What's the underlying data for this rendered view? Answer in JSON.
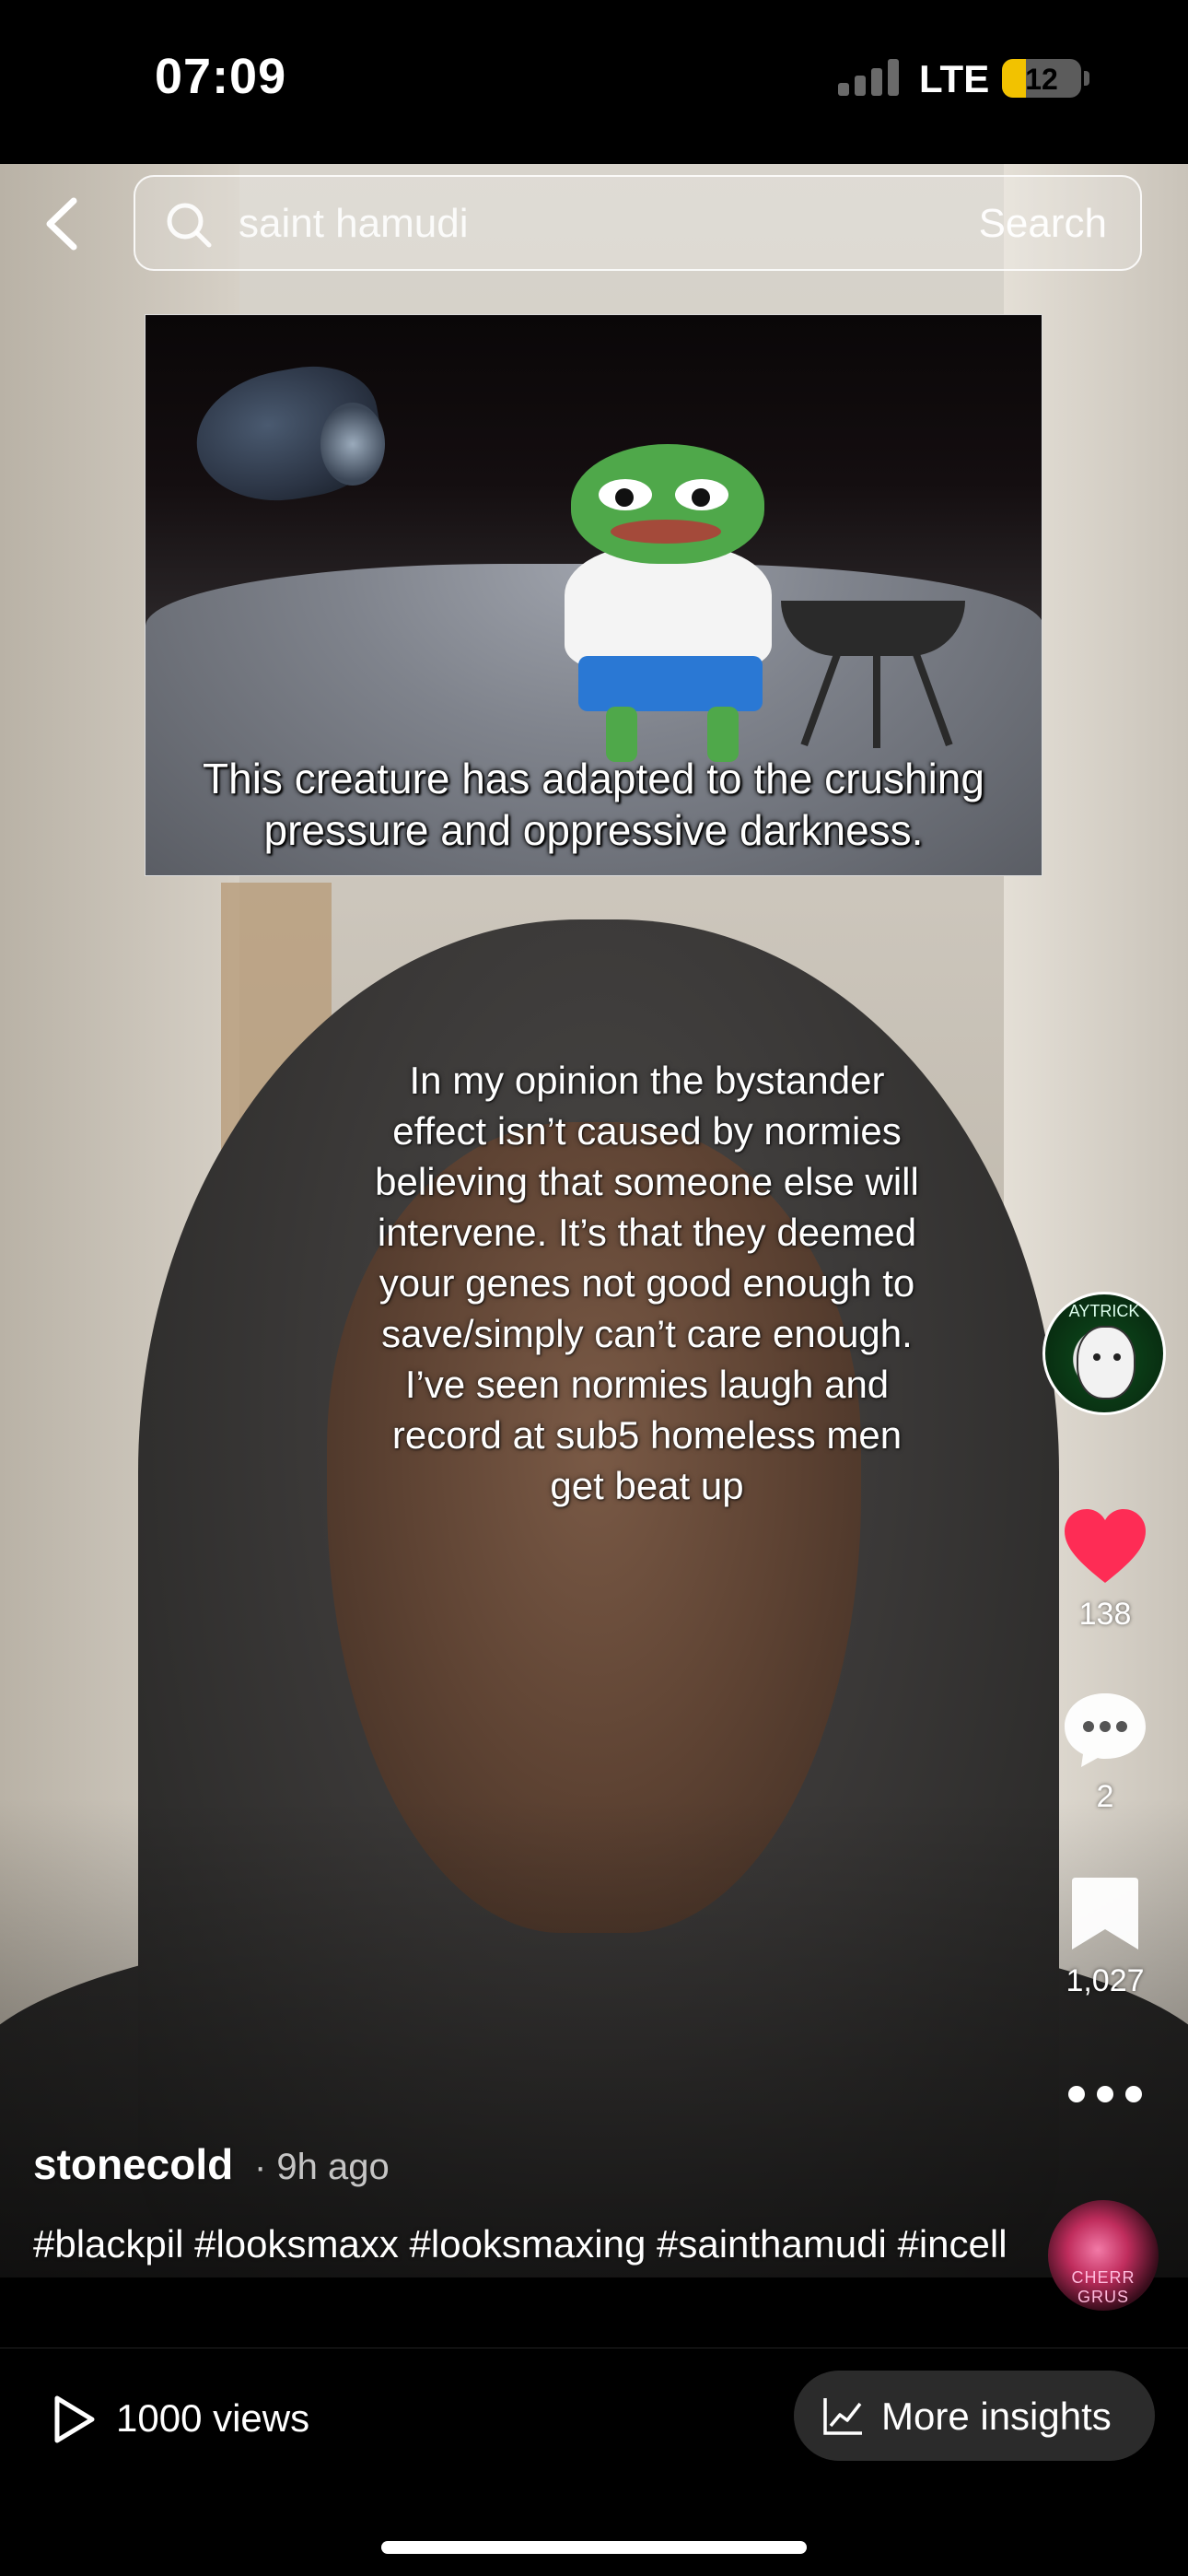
{
  "status_bar": {
    "time": "07:09",
    "network": "LTE",
    "battery": "12",
    "battery_level_percent": 12,
    "battery_color": "#f2c200"
  },
  "search": {
    "query": "saint hamudi",
    "button_label": "Search"
  },
  "meme": {
    "caption": "This creature has adapted to the crushing pressure and oppressive darkness."
  },
  "video": {
    "overlay_text": "In my opinion the bystander effect isn’t caused by normies believing that someone else will intervene. It’s that they deemed your genes not good enough to save/simply can’t care enough. I’ve seen normies laugh and record at sub5 homeless men get beat up"
  },
  "creator": {
    "avatar_tag": "AYTRICK"
  },
  "actions": {
    "likes": "138",
    "comments": "2",
    "saves": "1,027",
    "like_color": "#fe2c55"
  },
  "caption": {
    "username": "stonecold",
    "time_ago": "· 9h ago",
    "hashtags": "#blackpil #looksmaxx #looksmaxing #sainthamudi #incell"
  },
  "music": {
    "disc_text": "CHERR GRUS"
  },
  "bottom_bar": {
    "views": "1000 views",
    "insights_label": "More insights"
  },
  "icons": {
    "back": "chevron-left-icon",
    "search": "search-icon",
    "like": "heart-icon",
    "comment": "comment-bubble-icon",
    "save": "bookmark-icon",
    "more": "more-dots-icon",
    "views": "play-icon",
    "insights": "line-chart-icon"
  }
}
